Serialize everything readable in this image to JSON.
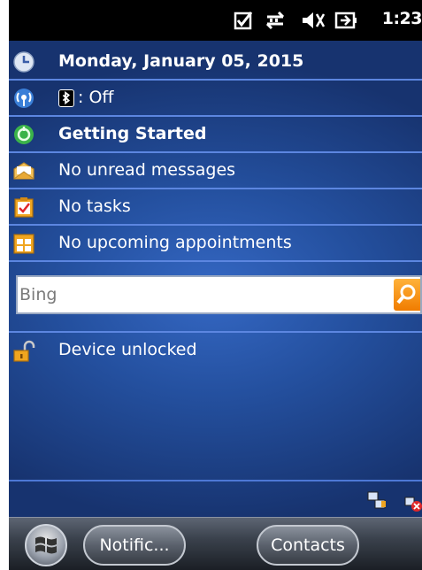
{
  "status_bar": {
    "time": "1:23",
    "icons": [
      "notification-check-icon",
      "connectivity-arrows-icon",
      "volume-muted-icon",
      "battery-charging-icon"
    ]
  },
  "today": {
    "date": "Monday, January 05, 2015",
    "bluetooth": ": Off",
    "getting_started": "Getting Started",
    "messages": "No unread messages",
    "tasks": "No tasks",
    "appointments": "No upcoming appointments",
    "device_lock": "Device unlocked"
  },
  "search": {
    "placeholder": "Bing"
  },
  "taskbar": {
    "left_softkey": "Notific...",
    "right_softkey": "Contacts"
  },
  "colors": {
    "background_blue": "#24509f",
    "row_divider": "#5c86e0",
    "search_button_orange": "#f07c00",
    "status_bar": "#000000"
  }
}
